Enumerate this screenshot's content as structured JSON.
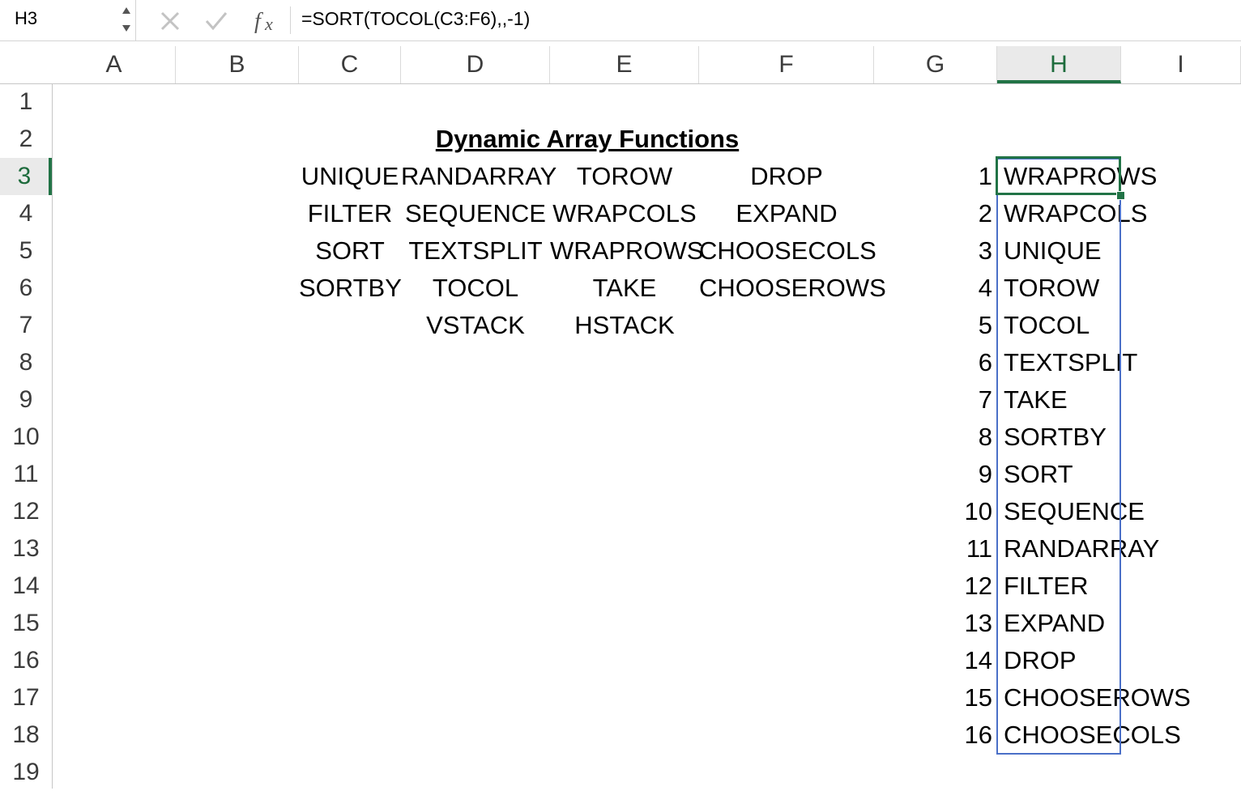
{
  "formula_bar": {
    "name_box": "H3",
    "formula": "=SORT(TOCOL(C3:F6),,-1)",
    "icons": [
      "cancel-icon",
      "enter-icon",
      "function-icon"
    ]
  },
  "columns": [
    "A",
    "B",
    "C",
    "D",
    "E",
    "F",
    "G",
    "H",
    "I"
  ],
  "rows": [
    "1",
    "2",
    "3",
    "4",
    "5",
    "6",
    "7",
    "8",
    "9",
    "10",
    "11",
    "12",
    "13",
    "14",
    "15",
    "16",
    "17",
    "18",
    "19"
  ],
  "selected_cell": "H3",
  "sheet": {
    "title": "Dynamic Array Functions",
    "source_table": [
      [
        "UNIQUE",
        "RANDARRAY",
        "TOROW",
        "DROP"
      ],
      [
        "FILTER",
        "SEQUENCE",
        "WRAPCOLS",
        "EXPAND"
      ],
      [
        "SORT",
        "TEXTSPLIT",
        "WRAPROWS",
        "CHOOSECOLS"
      ],
      [
        "SORTBY",
        "TOCOL",
        "TAKE",
        "CHOOSEROWS"
      ],
      [
        "",
        "VSTACK",
        "HSTACK",
        ""
      ]
    ],
    "result_numbers": [
      "1",
      "2",
      "3",
      "4",
      "5",
      "6",
      "7",
      "8",
      "9",
      "10",
      "11",
      "12",
      "13",
      "14",
      "15",
      "16"
    ],
    "result_values": [
      "WRAPROWS",
      "WRAPCOLS",
      "UNIQUE",
      "TOROW",
      "TOCOL",
      "TEXTSPLIT",
      "TAKE",
      "SORTBY",
      "SORT",
      "SEQUENCE",
      "RANDARRAY",
      "FILTER",
      "EXPAND",
      "DROP",
      "CHOOSEROWS",
      "CHOOSECOLS"
    ]
  },
  "colors": {
    "accent": "#217346",
    "spill_border": "#4a6fc7"
  }
}
